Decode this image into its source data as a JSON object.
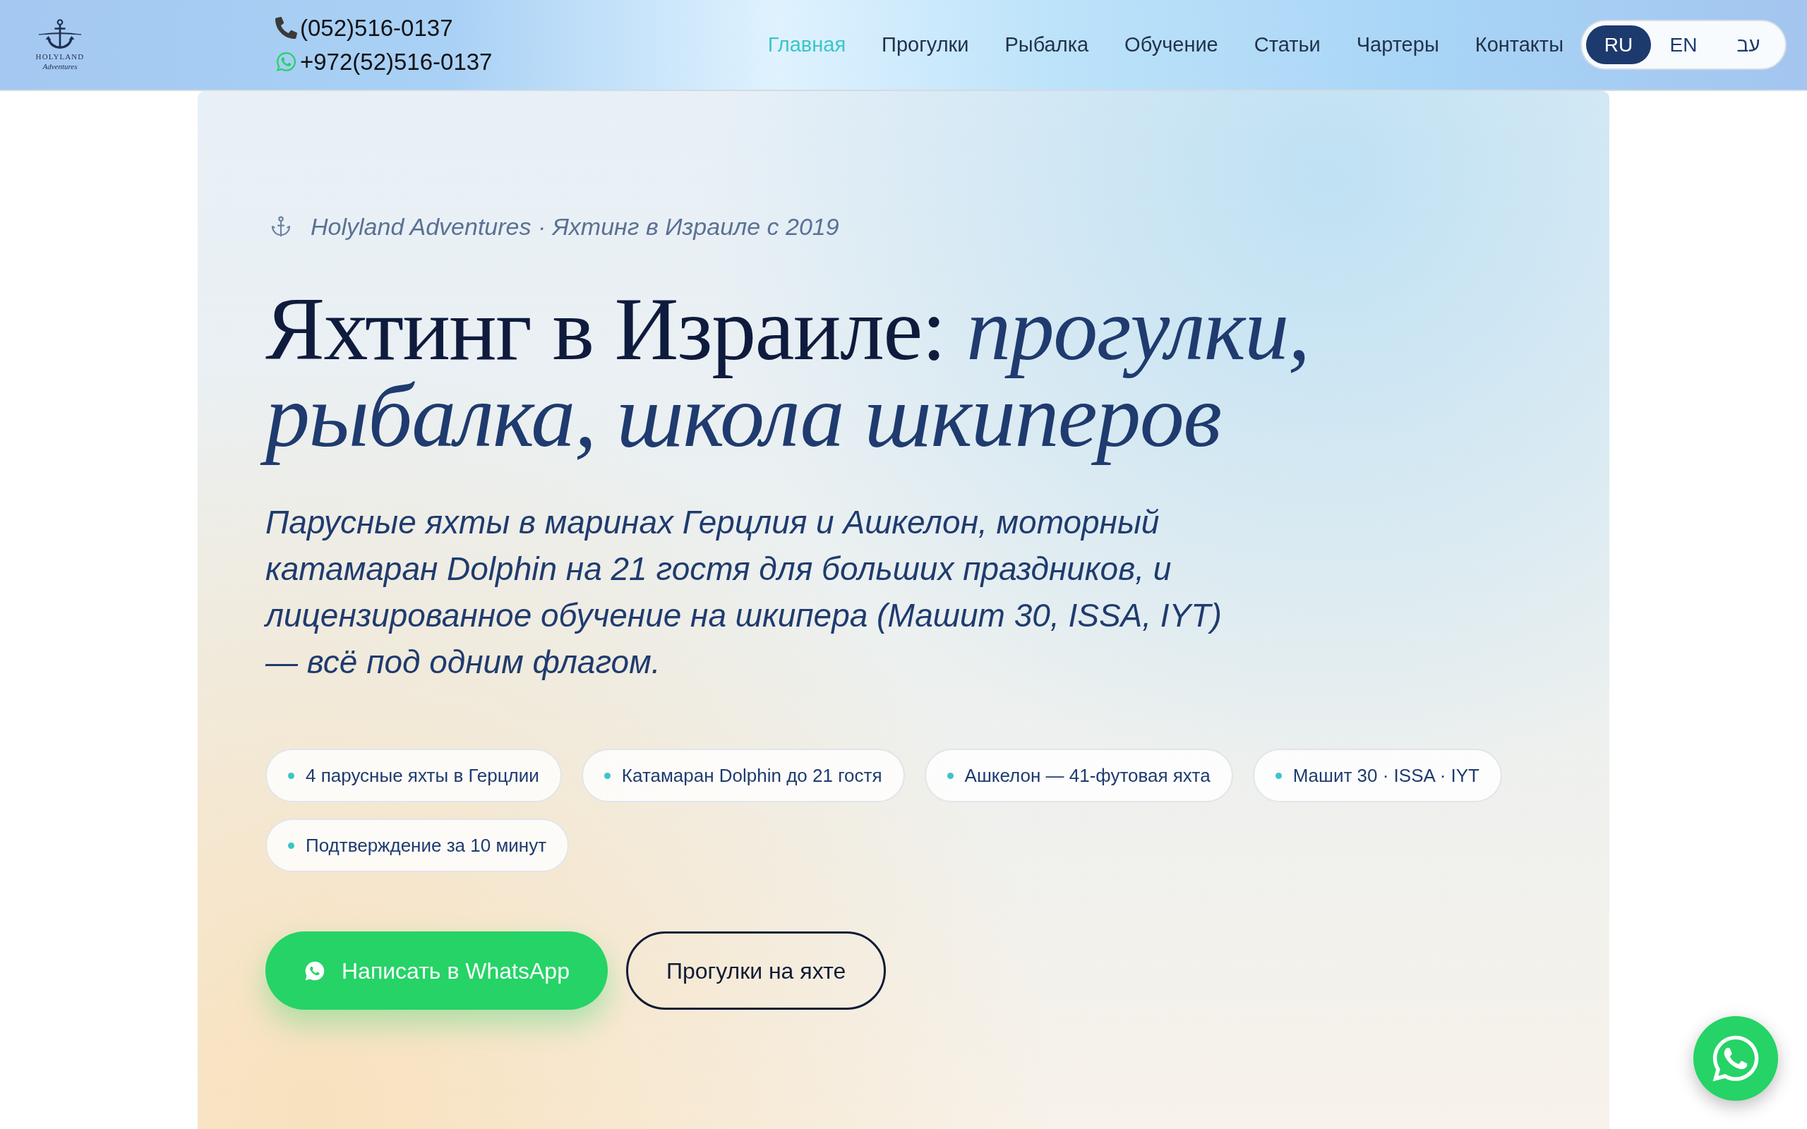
{
  "header": {
    "logo": {
      "name": "HOLYLAND",
      "tagline": "Adventures"
    },
    "contacts": [
      {
        "kind": "phone",
        "number": "(052)516-0137"
      },
      {
        "kind": "whatsapp",
        "number": "+972(52)516-0137"
      }
    ],
    "nav": [
      {
        "label": "Главная",
        "selected": true
      },
      {
        "label": "Прогулки",
        "selected": false
      },
      {
        "label": "Рыбалка",
        "selected": false
      },
      {
        "label": "Обучение",
        "selected": false
      },
      {
        "label": "Статьи",
        "selected": false
      },
      {
        "label": "Чартеры",
        "selected": false
      },
      {
        "label": "Контакты",
        "selected": false
      }
    ],
    "languages": [
      {
        "label": "RU",
        "selected": true
      },
      {
        "label": "EN",
        "selected": false
      },
      {
        "label": "עב",
        "selected": false
      }
    ]
  },
  "hero": {
    "eyebrow": "Holyland Adventures · Яхтинг в Израиле с 2019",
    "title": "Яхтинг в Израиле: *прогулки, рыбалка, школа шкиперов*",
    "lead": "Парусные яхты в маринах Герцлия и Ашкелон, моторный катамаран Dolphin на 21 гостя для больших праздников, и лицензированное обучение на шкипера (Машит 30, ISSA, IYT) — всё под одним флагом.",
    "highlights": [
      "4 парусные яхты в Герцлии",
      "Катамаран Dolphin до 21 гостя",
      "Ашкелон — 41-футовая яхта",
      "Машит 30 · ISSA · IYT",
      "Подтверждение за 10 минут"
    ],
    "actions": [
      {
        "kind": "whatsapp",
        "label": "Написать в WhatsApp"
      },
      {
        "kind": "outline",
        "label": "Прогулки на яхте"
      }
    ]
  }
}
